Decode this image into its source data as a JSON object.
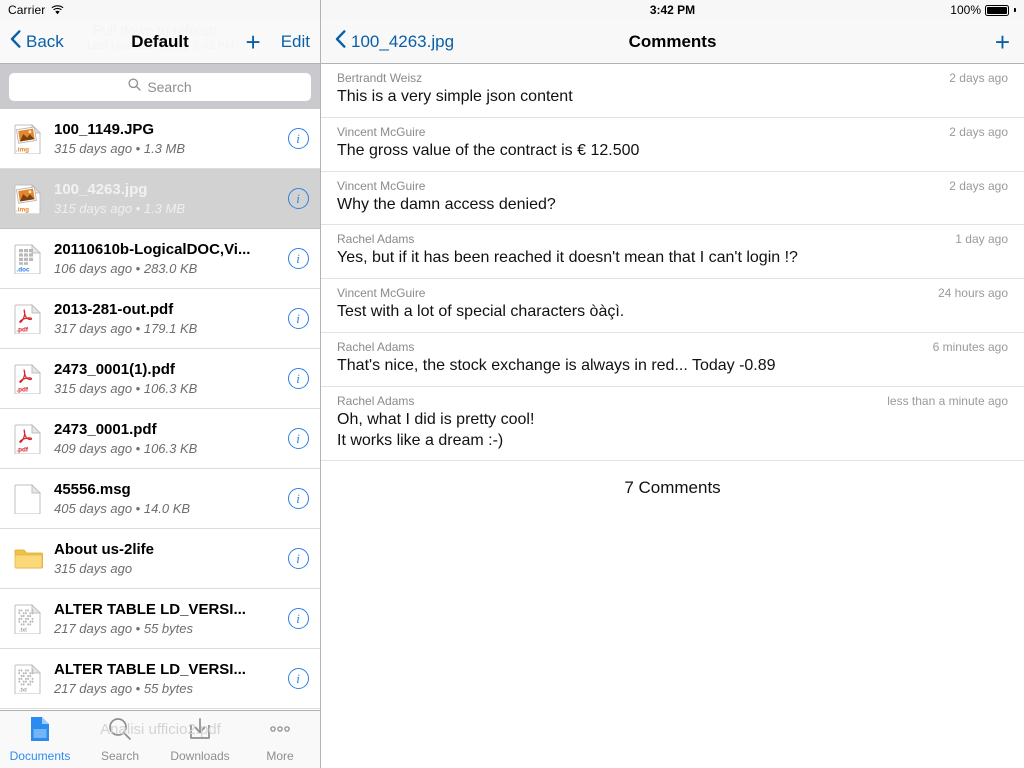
{
  "status_bar": {
    "carrier": "Carrier",
    "wifi_icon": "wifi-icon",
    "time": "3:42 PM",
    "battery_percent": "100%",
    "battery_level": 100
  },
  "master": {
    "nav": {
      "back_label": "Back",
      "back_icon": "chevron-left-icon",
      "title": "Default",
      "add_icon": "plus-icon",
      "add_label": "+",
      "edit_label": "Edit"
    },
    "ghost": {
      "pull_to_refresh": "Pull down to refresh...",
      "last_updated": "Last Updated: Today, 3:42 PM",
      "background_doc": "Analisi ufficio2.pdf"
    },
    "search": {
      "placeholder": "Search",
      "icon": "search-icon",
      "value": ""
    },
    "files": [
      {
        "name": "100_1149.JPG",
        "meta": "315 days ago • 1.3 MB",
        "icon": "image-file-icon",
        "kind": "img",
        "selected": false,
        "info_label": "i"
      },
      {
        "name": "100_4263.jpg",
        "meta": "315 days ago • 1.3 MB",
        "icon": "image-file-icon",
        "kind": "img",
        "selected": true,
        "info_label": "i"
      },
      {
        "name": "20110610b-LogicalDOC,Vi...",
        "meta": "106 days ago • 283.0 KB",
        "icon": "word-file-icon",
        "kind": "doc",
        "selected": false,
        "info_label": "i"
      },
      {
        "name": "2013-281-out.pdf",
        "meta": "317 days ago • 179.1 KB",
        "icon": "pdf-file-icon",
        "kind": "pdf",
        "selected": false,
        "info_label": "i"
      },
      {
        "name": "2473_0001(1).pdf",
        "meta": "315 days ago • 106.3 KB",
        "icon": "pdf-file-icon",
        "kind": "pdf",
        "selected": false,
        "info_label": "i"
      },
      {
        "name": "2473_0001.pdf",
        "meta": "409 days ago • 106.3 KB",
        "icon": "pdf-file-icon",
        "kind": "pdf",
        "selected": false,
        "info_label": "i"
      },
      {
        "name": "45556.msg",
        "meta": "405 days ago • 14.0 KB",
        "icon": "blank-file-icon",
        "kind": "blank",
        "selected": false,
        "info_label": "i"
      },
      {
        "name": "About us-2life",
        "meta": "315 days ago",
        "icon": "folder-icon",
        "kind": "folder",
        "selected": false,
        "info_label": "i"
      },
      {
        "name": "ALTER TABLE LD_VERSI...",
        "meta": "217 days ago • 55 bytes",
        "icon": "text-file-icon",
        "kind": "text",
        "selected": false,
        "info_label": "i"
      },
      {
        "name": "ALTER TABLE LD_VERSI...",
        "meta": "217 days ago • 55 bytes",
        "icon": "text-file-icon",
        "kind": "text",
        "selected": false,
        "info_label": "i"
      }
    ],
    "tabs": [
      {
        "label": "Documents",
        "icon": "document-icon",
        "active": true
      },
      {
        "label": "Search",
        "icon": "search-icon",
        "active": false
      },
      {
        "label": "Downloads",
        "icon": "download-icon",
        "active": false
      },
      {
        "label": "More",
        "icon": "ellipsis-icon",
        "active": false
      }
    ]
  },
  "detail": {
    "nav": {
      "back_label": "100_4263.jpg",
      "back_icon": "chevron-left-icon",
      "title": "Comments",
      "add_label": "+",
      "add_icon": "plus-icon"
    },
    "comments": [
      {
        "author": "Bertrandt Weisz",
        "time": "2 days ago",
        "body": "This is a very simple json content"
      },
      {
        "author": "Vincent McGuire",
        "time": "2 days ago",
        "body": "The gross value of the contract is € 12.500"
      },
      {
        "author": "Vincent McGuire",
        "time": "2 days ago",
        "body": "Why the damn access denied?"
      },
      {
        "author": "Rachel Adams",
        "time": "1 day ago",
        "body": "Yes, but if it has been reached it doesn't mean that I can't login !?"
      },
      {
        "author": "Vincent McGuire",
        "time": "24 hours ago",
        "body": "Test with a lot of special characters òàçì."
      },
      {
        "author": "Rachel Adams",
        "time": "6 minutes ago",
        "body": "That's nice, the stock exchange is always in red... Today -0.89"
      },
      {
        "author": "Rachel Adams",
        "time": "less than a minute ago",
        "body": "Oh, what I did is pretty cool!\nIt works like a dream :-)"
      }
    ],
    "footer": "7 Comments"
  },
  "colors": {
    "accent_blue": "#0a60a8",
    "tab_active_blue": "#2b8cf0",
    "info_blue": "#2f7fe0",
    "selected_row": "#d2d2d2",
    "search_bg": "#c9c9ce"
  }
}
